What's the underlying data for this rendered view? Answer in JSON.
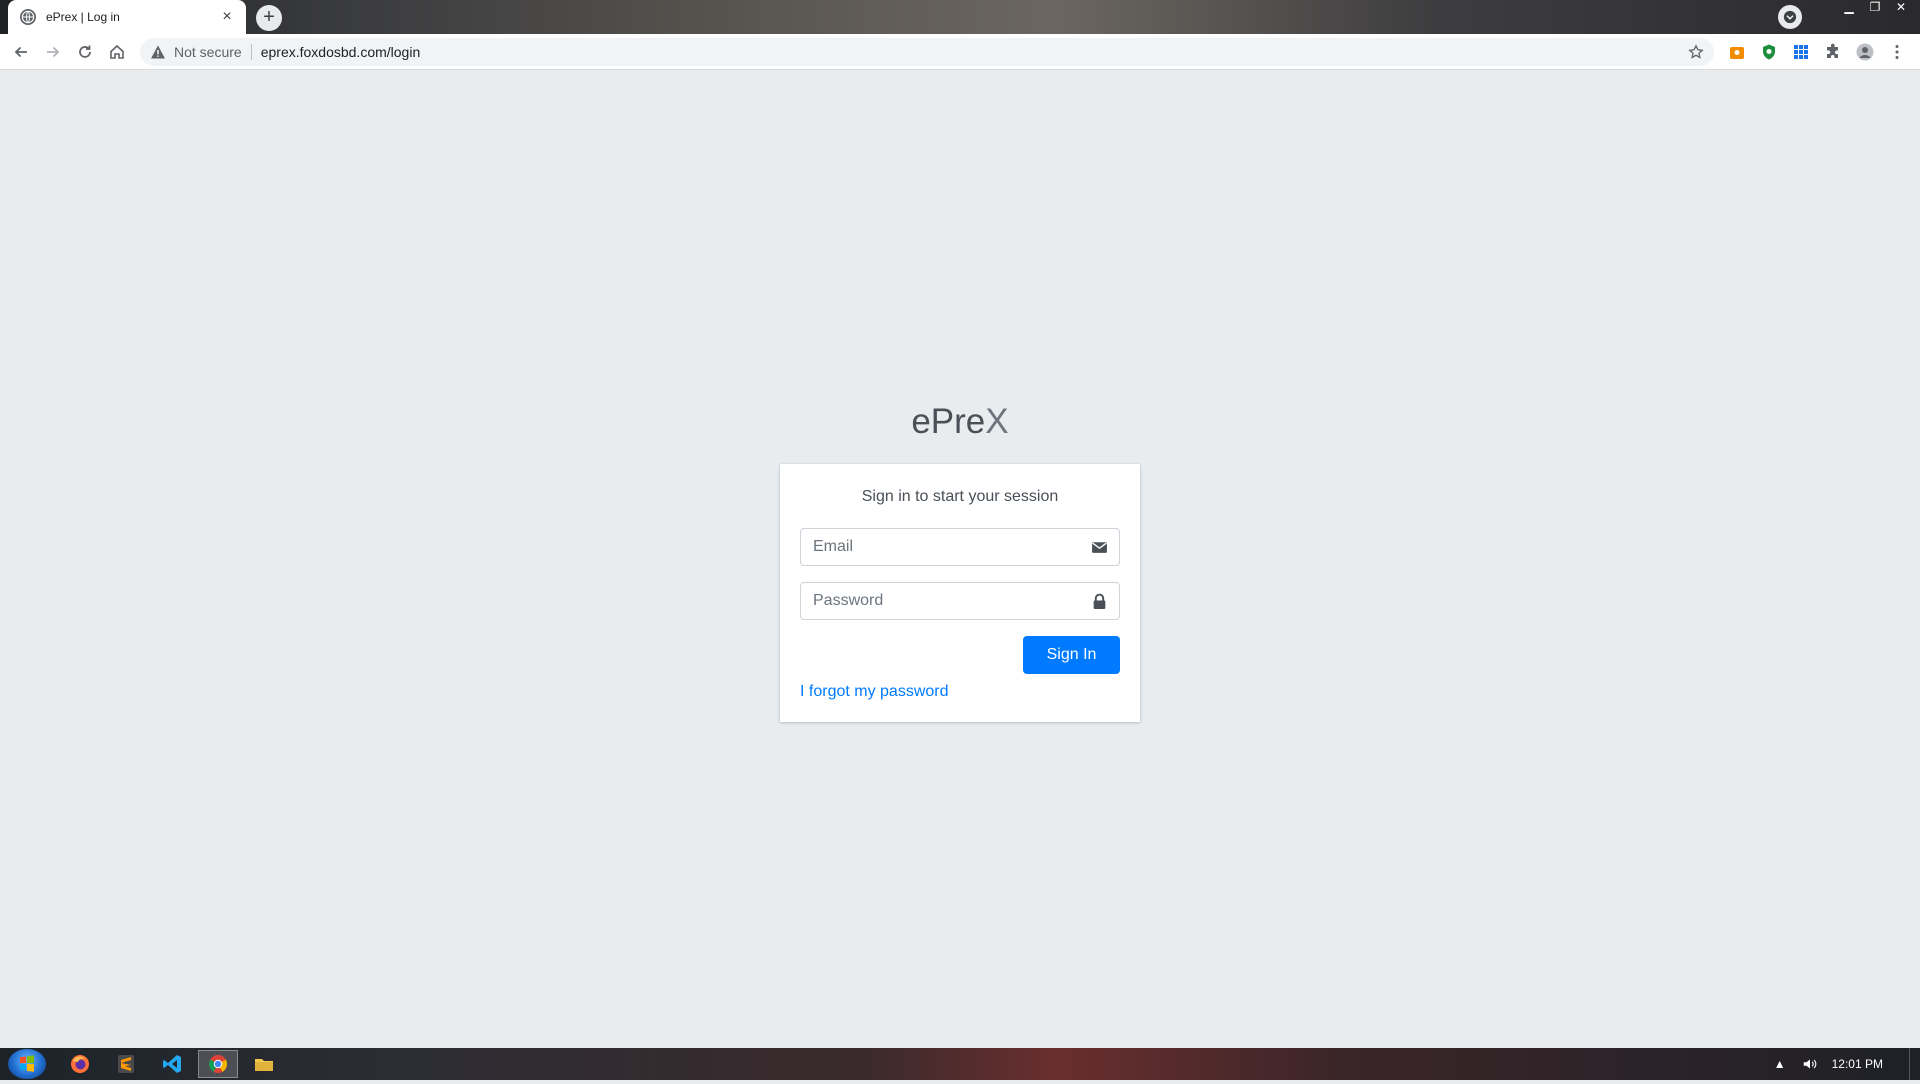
{
  "browser": {
    "tab_title": "ePrex | Log in",
    "tab_close": "×",
    "new_tab": "+",
    "security_label": "Not secure",
    "url": "eprex.foxdosbd.com/login"
  },
  "login": {
    "logo_main": "ePre",
    "logo_x": "X",
    "message": "Sign in to start your session",
    "email_placeholder": "Email",
    "password_placeholder": "Password",
    "signin_label": "Sign In",
    "forgot_label": "I forgot my password"
  },
  "colors": {
    "primary": "#007bff",
    "page_bg": "#e9ecef"
  },
  "taskbar": {
    "clock": "12:01 PM"
  }
}
